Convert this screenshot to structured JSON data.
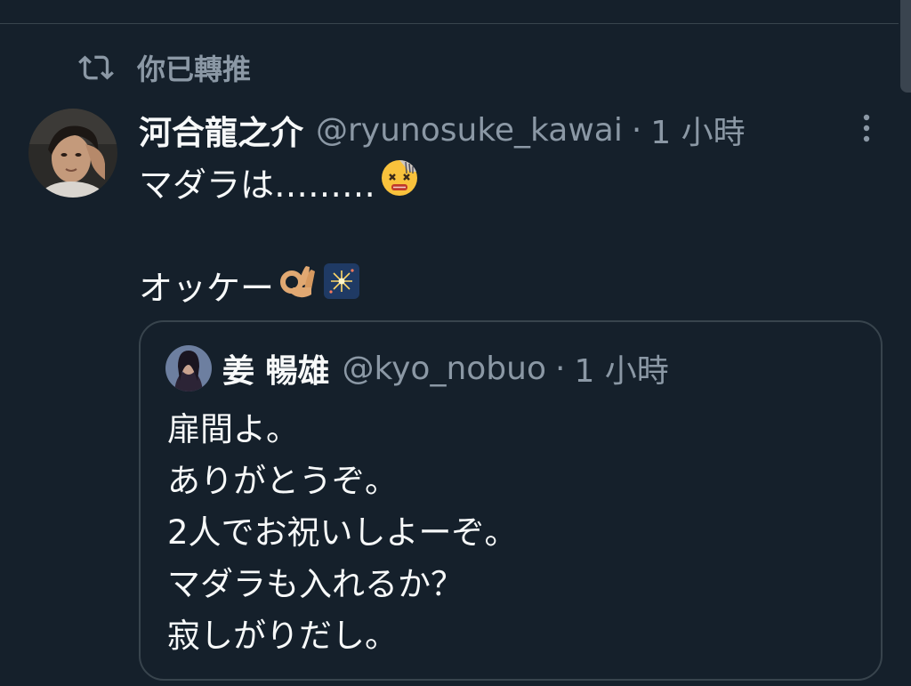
{
  "retweet": {
    "label": "你已轉推",
    "icon": "retweet-icon"
  },
  "tweet": {
    "author": {
      "display_name": "河合龍之介",
      "handle": "@ryunosuke_kawai",
      "separator": "·",
      "time": "1 小時"
    },
    "lines": [
      {
        "text": "マダラは………",
        "emoji": "dizzy-face-emoji"
      },
      {
        "text": "",
        "emoji": ""
      },
      {
        "text": "オッケー",
        "emoji": "ok-hand-emoji",
        "emoji2": "sparkler-emoji"
      }
    ],
    "more_icon": "more-vertical-icon"
  },
  "quote": {
    "author": {
      "display_name": "姜 暢雄",
      "handle": "@kyo_nobuo",
      "separator": "·",
      "time": "1 小時"
    },
    "lines": [
      "扉間よ。",
      "ありがとうぞ。",
      "2人でお祝いしよーぞ。",
      "マダラも入れるか？",
      "寂しがりだし。"
    ]
  },
  "colors": {
    "background": "#15202b",
    "text_primary": "#f7f9f9",
    "text_secondary": "#8b98a5",
    "border": "#38444d"
  }
}
